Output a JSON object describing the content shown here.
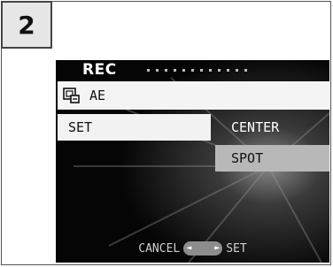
{
  "step": {
    "number": "2"
  },
  "screen": {
    "title": "REC",
    "ae_row": {
      "icon": "camera-mode-icon",
      "label": "AE"
    },
    "set_row": {
      "label": "SET"
    },
    "options": [
      {
        "label": "CENTER",
        "selected": false
      },
      {
        "label": "SPOT",
        "selected": true
      }
    ],
    "hint": {
      "cancel_label": "CANCEL",
      "set_label": "SET",
      "left_arrow": "◄",
      "right_arrow": "►"
    }
  },
  "colors": {
    "screen_bg": "#050505",
    "highlight": "#b8b8b8",
    "row_bg": "#f4f4f4"
  }
}
